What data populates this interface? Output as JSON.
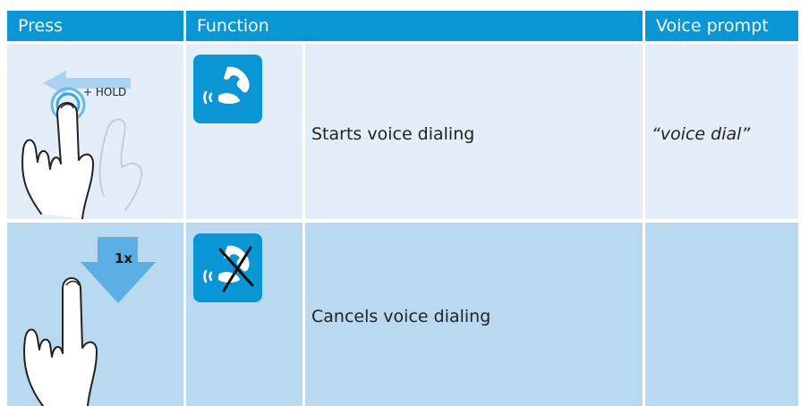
{
  "headers": {
    "press": "Press",
    "function": "Function",
    "voice_prompt": "Voice prompt"
  },
  "rows": [
    {
      "press_gesture": "swipe-left-hold",
      "press_label": "+ HOLD",
      "icon": "phone-voice-dial-icon",
      "function": "Starts voice dialing",
      "voice_prompt": "“voice dial”"
    },
    {
      "press_gesture": "tap-once",
      "press_label": "1x",
      "icon": "phone-voice-dial-cancel-icon",
      "function": "Cancels voice dialing",
      "voice_prompt": ""
    }
  ],
  "colors": {
    "header_bg": "#0996d4",
    "row1_bg": "#e4eef8",
    "row2_bg": "#b9d9f1",
    "icon_bg": "#0a96d4",
    "arrow": "#5aaee3"
  }
}
